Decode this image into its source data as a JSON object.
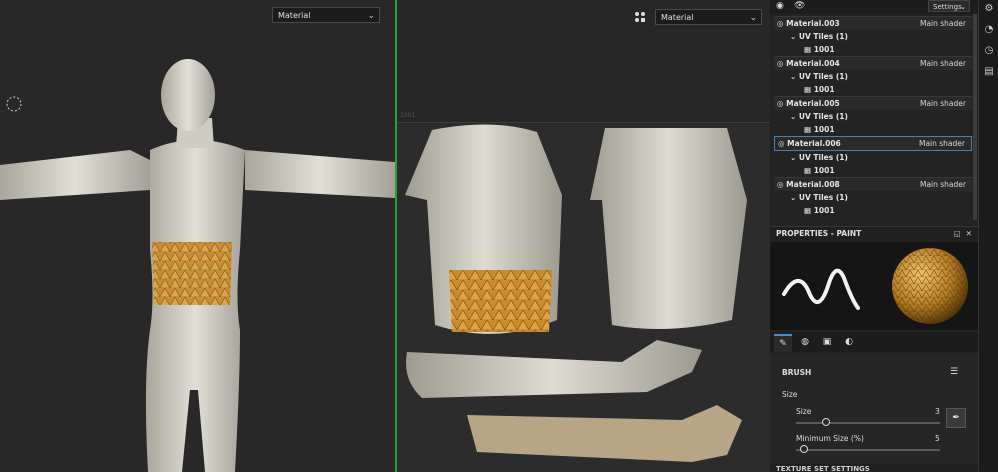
{
  "viewport3d": {
    "material_dropdown": "Material"
  },
  "viewport2d": {
    "material_dropdown": "Material",
    "uv_tile_label": "1001"
  },
  "panel": {
    "settings_label": "Settings",
    "materials": [
      {
        "name": "Material.003",
        "shader": "Main shader",
        "uv_tiles": "UV Tiles (1)",
        "tile": "1001",
        "selected": false
      },
      {
        "name": "Material.004",
        "shader": "Main shader",
        "uv_tiles": "UV Tiles (1)",
        "tile": "1001",
        "selected": false
      },
      {
        "name": "Material.005",
        "shader": "Main shader",
        "uv_tiles": "UV Tiles (1)",
        "tile": "1001",
        "selected": false
      },
      {
        "name": "Material.006",
        "shader": "Main shader",
        "uv_tiles": "UV Tiles (1)",
        "tile": "1001",
        "selected": true
      },
      {
        "name": "Material.008",
        "shader": "Main shader",
        "uv_tiles": "UV Tiles (1)",
        "tile": "1001",
        "selected": false
      }
    ],
    "properties_title": "PROPERTIES - PAINT",
    "brush": {
      "section_title": "BRUSH",
      "size_group_label": "Size",
      "size_label": "Size",
      "size_value": "3",
      "size_fraction": 0.2,
      "min_size_label": "Minimum Size (%)",
      "min_size_value": "5",
      "min_size_fraction": 0.05
    },
    "texture_set_title": "TEXTURE SET SETTINGS"
  },
  "colors": {
    "accent_blue": "#3d8fd1",
    "viewport_divider": "#2f9d2f",
    "material_gold": "#c88a2a",
    "skin": "#d9d6cc"
  }
}
